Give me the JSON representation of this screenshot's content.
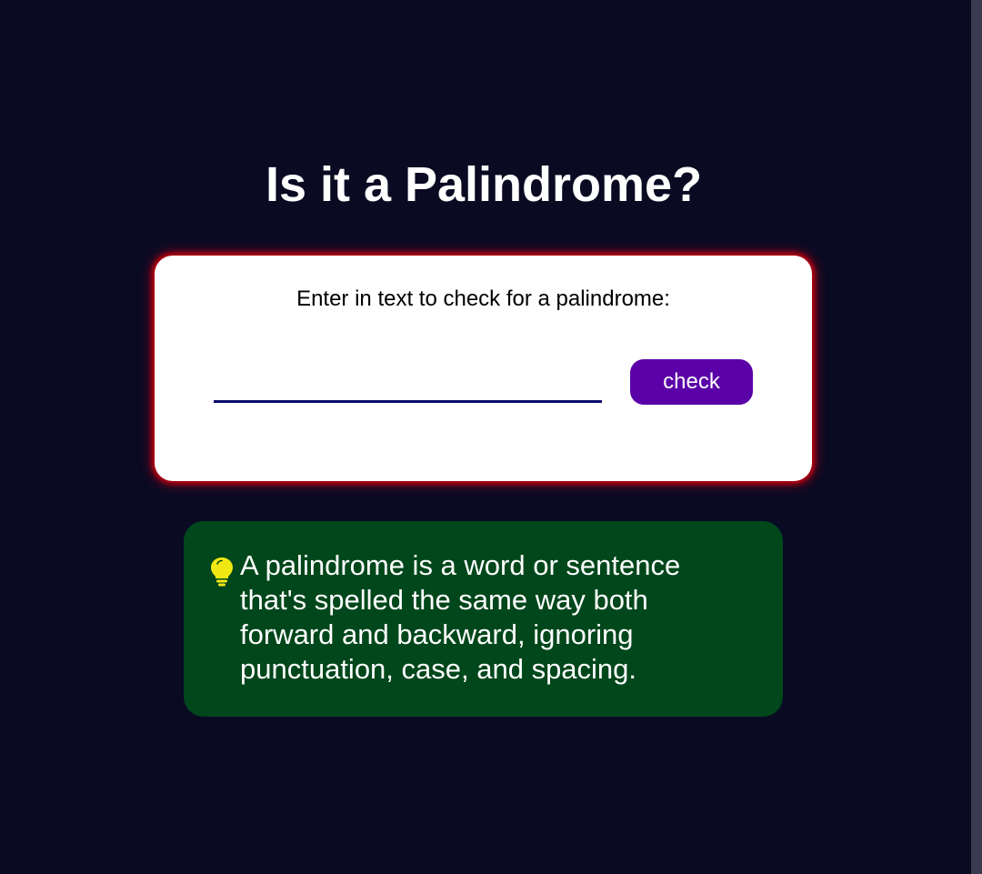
{
  "title": "Is it a Palindrome?",
  "checker": {
    "label": "Enter in text to check for a palindrome:",
    "input_value": "",
    "button_label": "check"
  },
  "info": {
    "icon": "lightbulb-icon",
    "text": "A palindrome is a word or sentence that's spelled the same way both forward and backward, ignoring punctuation, case, and spacing."
  },
  "colors": {
    "background": "#0a0a23",
    "card": "#ffffff",
    "card_glow": "#c00010",
    "button": "#5a01a7",
    "input_underline": "#0a0a6b",
    "info_box": "#00471b",
    "lightbulb": "#f1e813"
  }
}
